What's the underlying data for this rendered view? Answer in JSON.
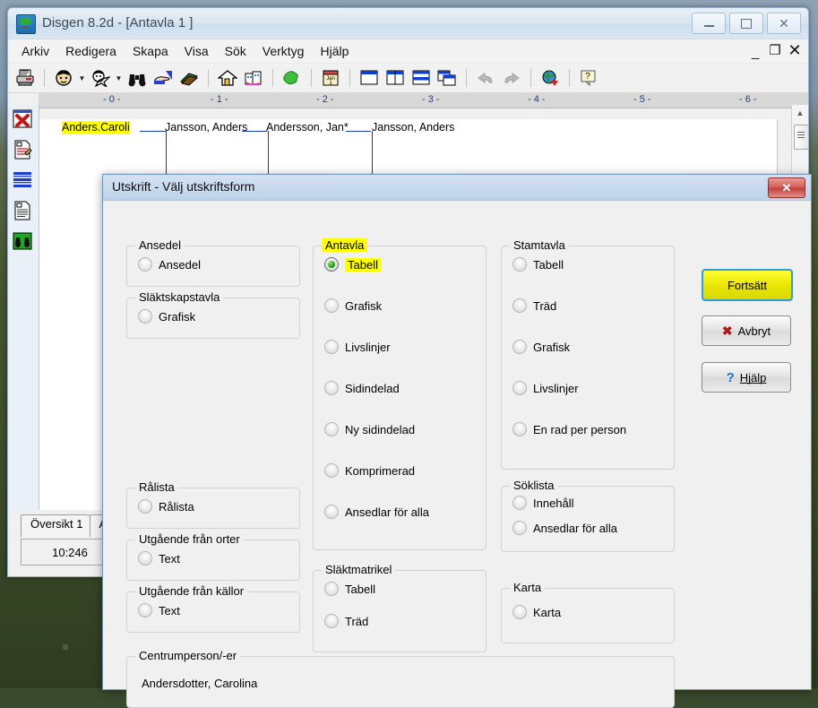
{
  "app": {
    "title": "Disgen 8.2d - [Antavla 1 ]",
    "icon": "tree-icon",
    "window_controls": [
      {
        "name": "minimize-button",
        "glyph": "minimize-icon"
      },
      {
        "name": "maximize-button",
        "glyph": "maximize-icon"
      },
      {
        "name": "close-button",
        "glyph": "✕"
      }
    ],
    "mdi_controls": [
      {
        "name": "mdi-minimize-button",
        "glyph": "_"
      },
      {
        "name": "mdi-restore-button",
        "glyph": "❐"
      },
      {
        "name": "mdi-close-button",
        "glyph": "✕"
      }
    ]
  },
  "menu": {
    "items": [
      {
        "label": "Arkiv"
      },
      {
        "label": "Redigera"
      },
      {
        "label": "Skapa"
      },
      {
        "label": "Visa"
      },
      {
        "label": "Sök"
      },
      {
        "label": "Verktyg"
      },
      {
        "label": "Hjälp"
      }
    ]
  },
  "toolbar": {
    "buttons": [
      {
        "name": "print-icon"
      },
      {
        "name": "person-icon"
      },
      {
        "name": "person-dropdown-caret"
      },
      {
        "name": "person-star-icon"
      },
      {
        "name": "person-star-dropdown-caret"
      },
      {
        "name": "binoculars-icon"
      },
      {
        "name": "pointing-hand-icon"
      },
      {
        "name": "book-icon"
      },
      {
        "name": "home-icon"
      },
      {
        "name": "buildings-icon"
      },
      {
        "name": "tree-crown-icon"
      },
      {
        "name": "calendar-icon"
      },
      {
        "name": "layout-single-icon"
      },
      {
        "name": "layout-columns-icon"
      },
      {
        "name": "layout-rows-icon"
      },
      {
        "name": "layout-cascade-icon"
      },
      {
        "name": "undo-icon"
      },
      {
        "name": "redo-icon"
      },
      {
        "name": "globe-icon"
      },
      {
        "name": "help-icon"
      }
    ],
    "calendar_label_top": "Jan",
    "calendar_label_bottom": "1"
  },
  "sidebar": {
    "tools": [
      {
        "name": "delete-red-x-icon"
      },
      {
        "name": "edit-document-icon"
      },
      {
        "name": "blue-list-icon"
      },
      {
        "name": "document-icon"
      },
      {
        "name": "green-search-icon"
      }
    ]
  },
  "ruler": {
    "ticks": [
      "- 0 -",
      "- 1 -",
      "- 2 -",
      "- 3 -",
      "- 4 -",
      "- 5 -",
      "- 6 -"
    ]
  },
  "chart_area": {
    "nodes": [
      {
        "label": "Anders.Caroli",
        "highlighted": true
      },
      {
        "label": "Jansson, Anders",
        "highlighted": false
      },
      {
        "label": "Andersson, Jan*",
        "highlighted": false
      },
      {
        "label": "Jansson, Anders",
        "highlighted": false
      }
    ]
  },
  "tabs": [
    {
      "label": "Översikt 1"
    },
    {
      "label": "A"
    }
  ],
  "status": {
    "coordinate": "10:246"
  },
  "dialog": {
    "title": "Utskrift - Välj utskriftsform",
    "close_label": "✕",
    "groups": {
      "ansedel": {
        "legend": "Ansedel",
        "legend_mnemonic_index": 3,
        "options": [
          {
            "label": "Ansedel",
            "selected": false
          }
        ]
      },
      "slaktskapstavla": {
        "legend": "Släktskapstavla",
        "options": [
          {
            "label": "Grafisk",
            "selected": false
          }
        ]
      },
      "ralista": {
        "legend": "Rålista",
        "options": [
          {
            "label": "Rålista",
            "selected": false
          }
        ]
      },
      "utgaende_orter": {
        "legend": "Utgående från orter",
        "options": [
          {
            "label": "Text",
            "selected": false
          }
        ]
      },
      "utgaende_kallor": {
        "legend": "Utgående från källor",
        "options": [
          {
            "label": "Text",
            "selected": false
          }
        ]
      },
      "antavla": {
        "legend": "Antavla",
        "legend_highlighted": true,
        "options": [
          {
            "label": "Tabell",
            "selected": true,
            "highlighted": true
          },
          {
            "label": "Grafisk",
            "selected": false
          },
          {
            "label": "Livslinjer",
            "selected": false
          },
          {
            "label": "Sidindelad",
            "selected": false
          },
          {
            "label": "Ny sidindelad",
            "selected": false
          },
          {
            "label": "Komprimerad",
            "selected": false
          },
          {
            "label": "Ansedlar för alla",
            "selected": false
          }
        ]
      },
      "slaktmatrikel": {
        "legend": "Släktmatrikel",
        "options": [
          {
            "label": "Tabell",
            "selected": false
          },
          {
            "label": "Träd",
            "selected": false
          }
        ]
      },
      "stamtavla": {
        "legend": "Stamtavla",
        "options": [
          {
            "label": "Tabell",
            "selected": false
          },
          {
            "label": "Träd",
            "selected": false
          },
          {
            "label": "Grafisk",
            "selected": false
          },
          {
            "label": "Livslinjer",
            "selected": false
          },
          {
            "label": "En rad per person",
            "selected": false
          }
        ]
      },
      "soklista": {
        "legend": "Söklista",
        "options": [
          {
            "label": "Innehåll",
            "selected": false
          },
          {
            "label": "Ansedlar för alla",
            "selected": false
          }
        ]
      },
      "karta": {
        "legend": "Karta",
        "options": [
          {
            "label": "Karta",
            "selected": false
          }
        ]
      },
      "centrumperson": {
        "legend": "Centrumperson/-er",
        "value": "Andersdotter, Carolina"
      }
    },
    "buttons": [
      {
        "name": "continue-button",
        "label": "Fortsätt",
        "primary": true
      },
      {
        "name": "cancel-button",
        "label": "Avbryt",
        "icon": "x-icon"
      },
      {
        "name": "help-button",
        "label": "Hjälp",
        "icon": "question-icon"
      }
    ]
  },
  "colors": {
    "highlight": "#ffff00",
    "selected_radio": "#1d9a14",
    "accent": "#2f9fd6",
    "tree_line": "#1a3aa8"
  }
}
